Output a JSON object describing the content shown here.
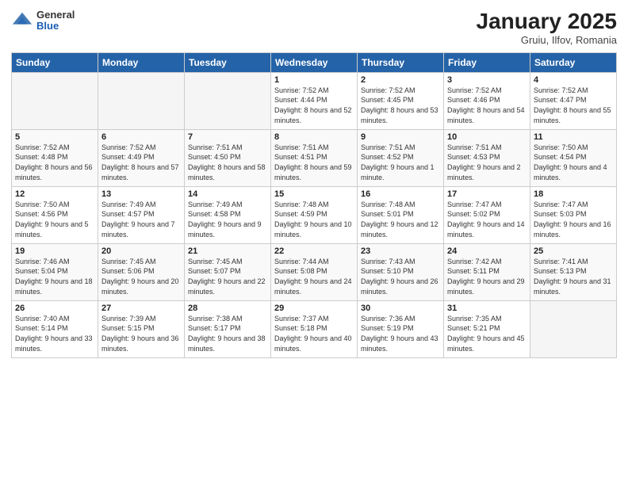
{
  "header": {
    "logo_general": "General",
    "logo_blue": "Blue",
    "title": "January 2025",
    "subtitle": "Gruiu, Ilfov, Romania"
  },
  "weekdays": [
    "Sunday",
    "Monday",
    "Tuesday",
    "Wednesday",
    "Thursday",
    "Friday",
    "Saturday"
  ],
  "weeks": [
    [
      {
        "day": "",
        "info": ""
      },
      {
        "day": "",
        "info": ""
      },
      {
        "day": "",
        "info": ""
      },
      {
        "day": "1",
        "info": "Sunrise: 7:52 AM\nSunset: 4:44 PM\nDaylight: 8 hours\nand 52 minutes."
      },
      {
        "day": "2",
        "info": "Sunrise: 7:52 AM\nSunset: 4:45 PM\nDaylight: 8 hours\nand 53 minutes."
      },
      {
        "day": "3",
        "info": "Sunrise: 7:52 AM\nSunset: 4:46 PM\nDaylight: 8 hours\nand 54 minutes."
      },
      {
        "day": "4",
        "info": "Sunrise: 7:52 AM\nSunset: 4:47 PM\nDaylight: 8 hours\nand 55 minutes."
      }
    ],
    [
      {
        "day": "5",
        "info": "Sunrise: 7:52 AM\nSunset: 4:48 PM\nDaylight: 8 hours\nand 56 minutes."
      },
      {
        "day": "6",
        "info": "Sunrise: 7:52 AM\nSunset: 4:49 PM\nDaylight: 8 hours\nand 57 minutes."
      },
      {
        "day": "7",
        "info": "Sunrise: 7:51 AM\nSunset: 4:50 PM\nDaylight: 8 hours\nand 58 minutes."
      },
      {
        "day": "8",
        "info": "Sunrise: 7:51 AM\nSunset: 4:51 PM\nDaylight: 8 hours\nand 59 minutes."
      },
      {
        "day": "9",
        "info": "Sunrise: 7:51 AM\nSunset: 4:52 PM\nDaylight: 9 hours\nand 1 minute."
      },
      {
        "day": "10",
        "info": "Sunrise: 7:51 AM\nSunset: 4:53 PM\nDaylight: 9 hours\nand 2 minutes."
      },
      {
        "day": "11",
        "info": "Sunrise: 7:50 AM\nSunset: 4:54 PM\nDaylight: 9 hours\nand 4 minutes."
      }
    ],
    [
      {
        "day": "12",
        "info": "Sunrise: 7:50 AM\nSunset: 4:56 PM\nDaylight: 9 hours\nand 5 minutes."
      },
      {
        "day": "13",
        "info": "Sunrise: 7:49 AM\nSunset: 4:57 PM\nDaylight: 9 hours\nand 7 minutes."
      },
      {
        "day": "14",
        "info": "Sunrise: 7:49 AM\nSunset: 4:58 PM\nDaylight: 9 hours\nand 9 minutes."
      },
      {
        "day": "15",
        "info": "Sunrise: 7:48 AM\nSunset: 4:59 PM\nDaylight: 9 hours\nand 10 minutes."
      },
      {
        "day": "16",
        "info": "Sunrise: 7:48 AM\nSunset: 5:01 PM\nDaylight: 9 hours\nand 12 minutes."
      },
      {
        "day": "17",
        "info": "Sunrise: 7:47 AM\nSunset: 5:02 PM\nDaylight: 9 hours\nand 14 minutes."
      },
      {
        "day": "18",
        "info": "Sunrise: 7:47 AM\nSunset: 5:03 PM\nDaylight: 9 hours\nand 16 minutes."
      }
    ],
    [
      {
        "day": "19",
        "info": "Sunrise: 7:46 AM\nSunset: 5:04 PM\nDaylight: 9 hours\nand 18 minutes."
      },
      {
        "day": "20",
        "info": "Sunrise: 7:45 AM\nSunset: 5:06 PM\nDaylight: 9 hours\nand 20 minutes."
      },
      {
        "day": "21",
        "info": "Sunrise: 7:45 AM\nSunset: 5:07 PM\nDaylight: 9 hours\nand 22 minutes."
      },
      {
        "day": "22",
        "info": "Sunrise: 7:44 AM\nSunset: 5:08 PM\nDaylight: 9 hours\nand 24 minutes."
      },
      {
        "day": "23",
        "info": "Sunrise: 7:43 AM\nSunset: 5:10 PM\nDaylight: 9 hours\nand 26 minutes."
      },
      {
        "day": "24",
        "info": "Sunrise: 7:42 AM\nSunset: 5:11 PM\nDaylight: 9 hours\nand 29 minutes."
      },
      {
        "day": "25",
        "info": "Sunrise: 7:41 AM\nSunset: 5:13 PM\nDaylight: 9 hours\nand 31 minutes."
      }
    ],
    [
      {
        "day": "26",
        "info": "Sunrise: 7:40 AM\nSunset: 5:14 PM\nDaylight: 9 hours\nand 33 minutes."
      },
      {
        "day": "27",
        "info": "Sunrise: 7:39 AM\nSunset: 5:15 PM\nDaylight: 9 hours\nand 36 minutes."
      },
      {
        "day": "28",
        "info": "Sunrise: 7:38 AM\nSunset: 5:17 PM\nDaylight: 9 hours\nand 38 minutes."
      },
      {
        "day": "29",
        "info": "Sunrise: 7:37 AM\nSunset: 5:18 PM\nDaylight: 9 hours\nand 40 minutes."
      },
      {
        "day": "30",
        "info": "Sunrise: 7:36 AM\nSunset: 5:19 PM\nDaylight: 9 hours\nand 43 minutes."
      },
      {
        "day": "31",
        "info": "Sunrise: 7:35 AM\nSunset: 5:21 PM\nDaylight: 9 hours\nand 45 minutes."
      },
      {
        "day": "",
        "info": ""
      }
    ]
  ]
}
